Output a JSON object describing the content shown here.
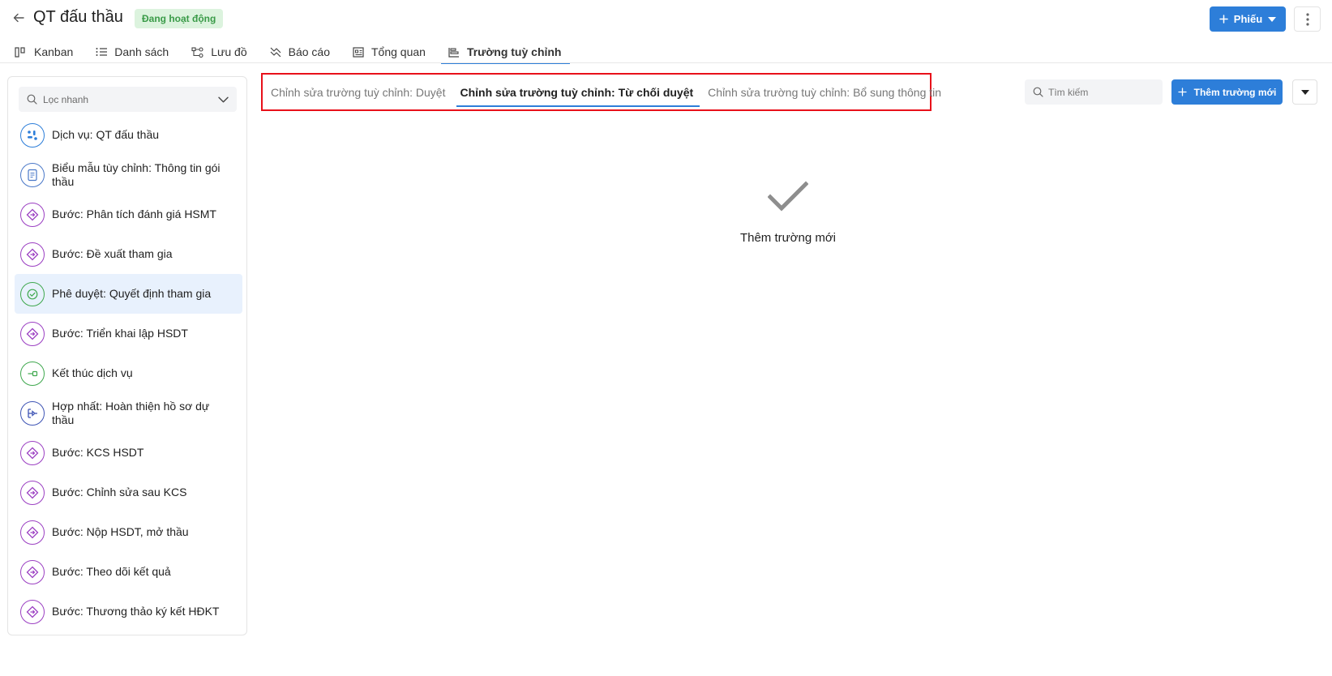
{
  "header": {
    "title": "QT đấu thầu",
    "status": "Đang hoạt động",
    "primary_button": "Phiếu"
  },
  "view_tabs": [
    {
      "label": "Kanban",
      "icon": "kanban-icon"
    },
    {
      "label": "Danh sách",
      "icon": "list-icon"
    },
    {
      "label": "Lưu đồ",
      "icon": "flowchart-icon"
    },
    {
      "label": "Báo cáo",
      "icon": "report-icon"
    },
    {
      "label": "Tổng quan",
      "icon": "overview-icon"
    },
    {
      "label": "Trường tuỳ chỉnh",
      "icon": "custom-fields-icon",
      "active": true
    }
  ],
  "sidebar": {
    "filter_placeholder": "Lọc nhanh",
    "items": [
      {
        "label": "Dịch vụ: QT đấu thầu",
        "type": "service",
        "color": "#2d7ed9"
      },
      {
        "label": "Biểu mẫu tùy chỉnh: Thông tin gói thầu",
        "type": "form",
        "color": "#4a78c8"
      },
      {
        "label": "Bước: Phân tích đánh giá HSMT",
        "type": "step",
        "color": "#9b3fc2"
      },
      {
        "label": "Bước: Đề xuất tham gia",
        "type": "step",
        "color": "#9b3fc2"
      },
      {
        "label": "Phê duyệt: Quyết định tham gia",
        "type": "approval",
        "color": "#3fa84e",
        "selected": true
      },
      {
        "label": "Bước: Triển khai lập HSDT",
        "type": "step",
        "color": "#9b3fc2"
      },
      {
        "label": "Kết thúc dịch vụ",
        "type": "end",
        "color": "#3fa84e"
      },
      {
        "label": "Hợp nhất: Hoàn thiện hồ sơ dự thầu",
        "type": "merge",
        "color": "#3f55b5"
      },
      {
        "label": "Bước: KCS HSDT",
        "type": "step",
        "color": "#9b3fc2"
      },
      {
        "label": "Bước: Chỉnh sửa sau KCS",
        "type": "step",
        "color": "#9b3fc2"
      },
      {
        "label": "Bước: Nộp HSDT, mở thầu",
        "type": "step",
        "color": "#9b3fc2"
      },
      {
        "label": "Bước: Theo dõi kết quả",
        "type": "step",
        "color": "#9b3fc2"
      },
      {
        "label": "Bước: Thương thảo ký kết HĐKT",
        "type": "step",
        "color": "#9b3fc2"
      }
    ]
  },
  "content": {
    "tabs": [
      {
        "label": "Chỉnh sửa trường tuỳ chỉnh: Duyệt"
      },
      {
        "label": "Chỉnh sửa trường tuỳ chỉnh: Từ chối duyệt",
        "active": true
      },
      {
        "label": "Chỉnh sửa trường tuỳ chỉnh: Bổ sung thông tin"
      }
    ],
    "search_placeholder": "Tìm kiếm",
    "add_button": "Thêm trường mới",
    "empty_text": "Thêm trường mới"
  }
}
